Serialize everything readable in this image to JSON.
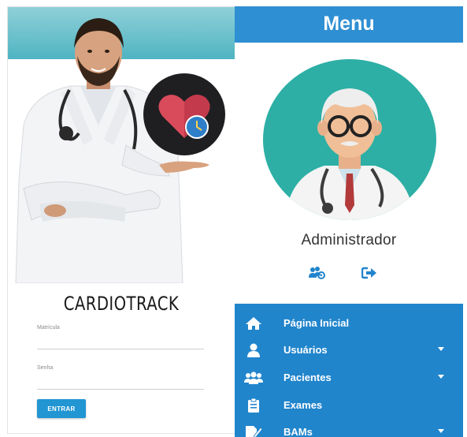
{
  "login": {
    "brand": "CARDIOTRACK",
    "username_label": "Matrícula",
    "password_label": "Senha",
    "submit_label": "ENTRAR"
  },
  "menu": {
    "title": "Menu",
    "user_name": "Administrador",
    "user_actions": [
      {
        "icon": "manage-users-icon"
      },
      {
        "icon": "logout-icon"
      }
    ],
    "items": [
      {
        "label": "Página Inicial",
        "icon": "home-icon",
        "has_submenu": false
      },
      {
        "label": "Usuários",
        "icon": "user-icon",
        "has_submenu": true
      },
      {
        "label": "Pacientes",
        "icon": "users-group-icon",
        "has_submenu": true
      },
      {
        "label": "Exames",
        "icon": "clipboard-icon",
        "has_submenu": false
      },
      {
        "label": "BAMs",
        "icon": "edit-document-icon",
        "has_submenu": true
      }
    ]
  },
  "colors": {
    "primary_blue": "#2185cc",
    "header_blue": "#2f8fd3",
    "button_blue": "#2196d3",
    "avatar_teal": "#2dafa5",
    "heart_red": "#d94b5b"
  }
}
